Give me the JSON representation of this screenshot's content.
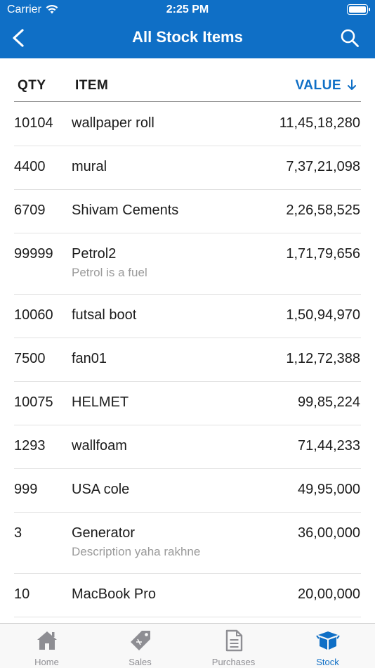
{
  "status_bar": {
    "carrier": "Carrier",
    "time": "2:25 PM"
  },
  "nav": {
    "title": "All Stock Items",
    "back_icon": "chevron-left-icon",
    "search_icon": "search-icon"
  },
  "table": {
    "headers": {
      "qty": "QTY",
      "item": "ITEM",
      "value": "VALUE"
    },
    "sort": {
      "column": "value",
      "direction": "descending"
    },
    "rows": [
      {
        "qty": "10104",
        "name": "wallpaper roll",
        "description": "",
        "value": "11,45,18,280"
      },
      {
        "qty": "4400",
        "name": "mural",
        "description": "",
        "value": "7,37,21,098"
      },
      {
        "qty": "6709",
        "name": "Shivam Cements",
        "description": "",
        "value": "2,26,58,525"
      },
      {
        "qty": "99999",
        "name": "Petrol2",
        "description": "Petrol is a fuel",
        "value": "1,71,79,656"
      },
      {
        "qty": "10060",
        "name": "futsal boot",
        "description": "",
        "value": "1,50,94,970"
      },
      {
        "qty": "7500",
        "name": "fan01",
        "description": "",
        "value": "1,12,72,388"
      },
      {
        "qty": "10075",
        "name": "HELMET",
        "description": "",
        "value": "99,85,224"
      },
      {
        "qty": "1293",
        "name": "wallfoam",
        "description": "",
        "value": "71,44,233"
      },
      {
        "qty": "999",
        "name": "USA cole",
        "description": "",
        "value": "49,95,000"
      },
      {
        "qty": "3",
        "name": "Generator",
        "description": "Description yaha rakhne",
        "value": "36,00,000"
      },
      {
        "qty": "10",
        "name": "MacBook Pro",
        "description": "",
        "value": "20,00,000"
      }
    ]
  },
  "tabs": [
    {
      "label": "Home",
      "icon": "home-icon",
      "active": false
    },
    {
      "label": "Sales",
      "icon": "tag-icon",
      "active": false
    },
    {
      "label": "Purchases",
      "icon": "document-icon",
      "active": false
    },
    {
      "label": "Stock",
      "icon": "box-icon",
      "active": true
    }
  ],
  "colors": {
    "brand": "#0f6fc6",
    "inactive_tab": "#8e8e93"
  }
}
